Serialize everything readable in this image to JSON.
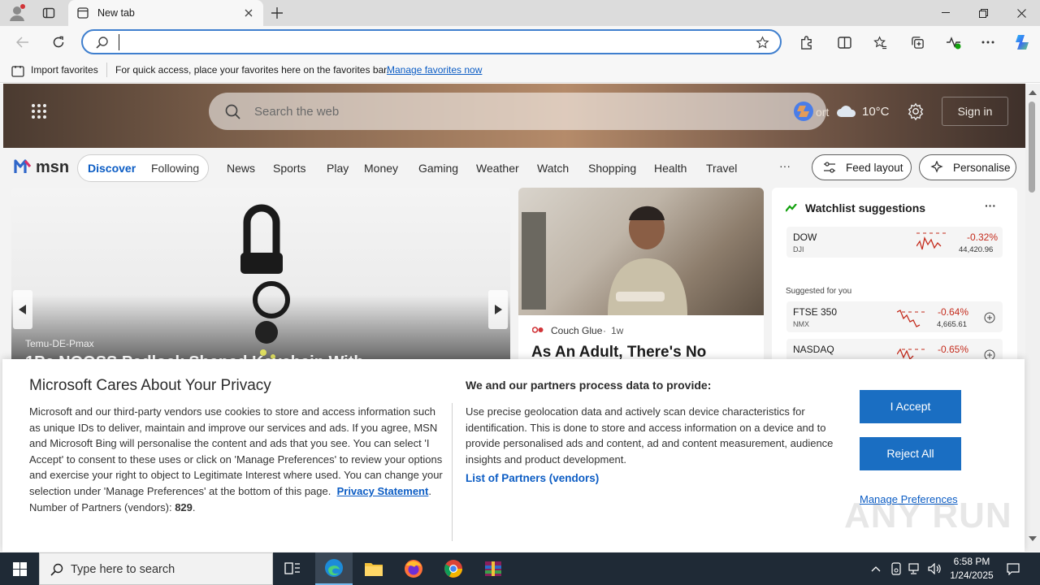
{
  "browser": {
    "tab_title": "New tab",
    "address_value": "",
    "favorites_bar": {
      "import_label": "Import favorites",
      "message": "For quick access, place your favorites here on the favorites bar.",
      "manage_link": "Manage favorites now"
    }
  },
  "msn": {
    "search_placeholder": "Search the web",
    "weather_temp": "10°C",
    "weather_city_partial": "ort",
    "signin_label": "Sign in",
    "logo_text": "msn",
    "pill_tabs": [
      "Discover",
      "Following"
    ],
    "nav_items": [
      "News",
      "Sports",
      "Play",
      "Money",
      "Gaming",
      "Weather",
      "Watch",
      "Shopping",
      "Health",
      "Travel"
    ],
    "more_label": "···",
    "feed_layout_label": "Feed layout",
    "personalise_label": "Personalise",
    "carousel": {
      "source": "Temu-DE-Pmax",
      "headline_partial": "1Pc NOOSS Padlock Shaped Keychain With"
    },
    "article": {
      "source": "Couch Glue",
      "age": "1w",
      "headline": "As An Adult, There's No"
    },
    "watchlist": {
      "title": "Watchlist suggestions",
      "more": "···",
      "main": {
        "symbol": "DOW",
        "sub": "DJI",
        "change": "-0.32%",
        "value": "44,420.96"
      },
      "suggested_label": "Suggested for you",
      "suggested": [
        {
          "symbol": "FTSE 350",
          "sub": "NMX",
          "change": "-0.64%",
          "value": "4,665.61"
        },
        {
          "symbol": "NASDAQ",
          "sub": "",
          "change": "-0.65%",
          "value": ""
        }
      ]
    }
  },
  "privacy": {
    "title": "Microsoft Cares About Your Privacy",
    "body": "Microsoft and our third-party vendors use cookies to store and access information such as unique IDs to deliver, maintain and improve our services and ads. If you agree, MSN and Microsoft Bing will personalise the content and ads that you see. You can select 'I Accept' to consent to these uses or click on 'Manage Preferences' to review your options and exercise your right to object to Legitimate Interest where used. You can change your selection under 'Manage Preferences' at the bottom of this page.",
    "privacy_link": "Privacy Statement",
    "partners_count_label": "Number of Partners (vendors):",
    "partners_count": "829",
    "right_title": "We and our partners process data to provide:",
    "right_body": "Use precise geolocation data and actively scan device characteristics for identification. This is done to store and access information on a device and to provide personalised ads and content, ad and content measurement, audience insights and product development.",
    "partners_link": "List of Partners (vendors)",
    "accept": "I Accept",
    "reject": "Reject All",
    "manage": "Manage Preferences"
  },
  "watermark": "ANY RUN",
  "taskbar": {
    "search_placeholder": "Type here to search",
    "time": "6:58 PM",
    "date": "1/24/2025"
  },
  "colors": {
    "accent": "#1a6ec2",
    "link": "#0b5cc4",
    "negative": "#c42b1c"
  }
}
